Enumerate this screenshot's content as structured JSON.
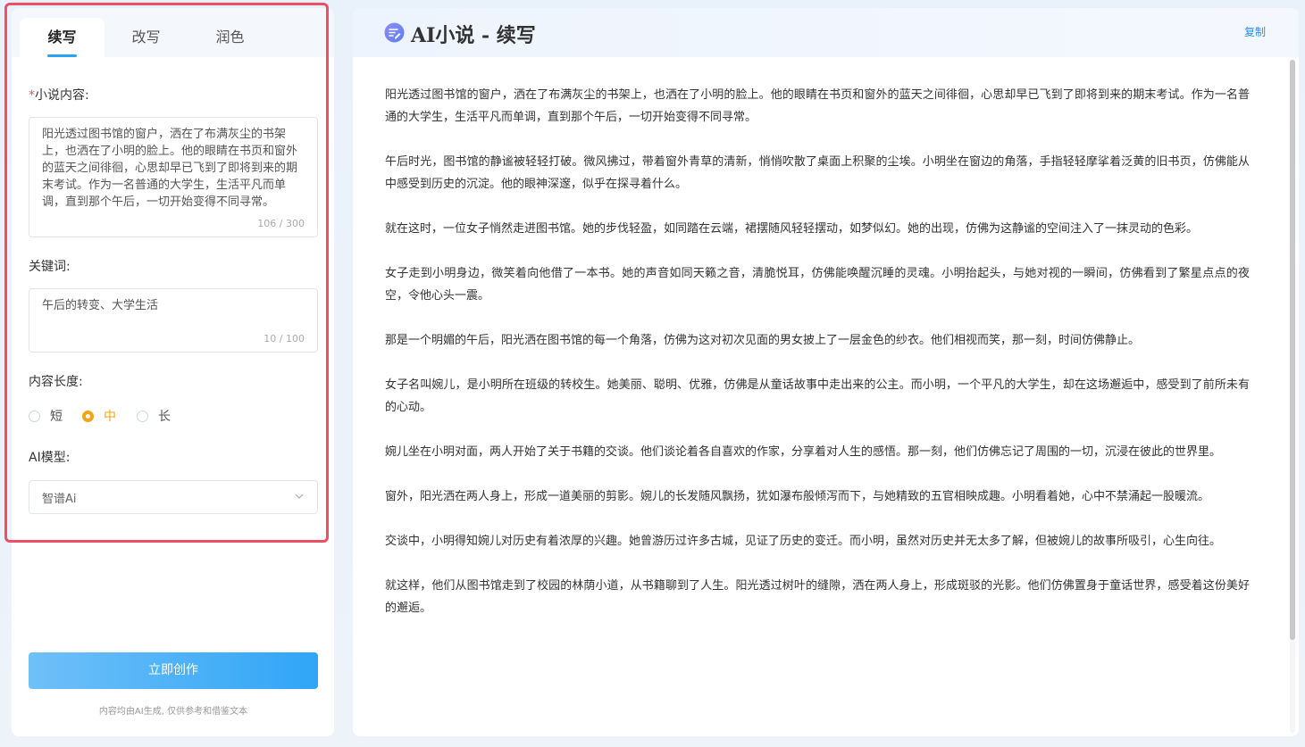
{
  "tabs": [
    {
      "label": "续写",
      "active": true
    },
    {
      "label": "改写",
      "active": false
    },
    {
      "label": "润色",
      "active": false
    }
  ],
  "form": {
    "novel_content": {
      "required_mark": "*",
      "label": "小说内容:",
      "value": "阳光透过图书馆的窗户，洒在了布满灰尘的书架上，也洒在了小明的脸上。他的眼睛在书页和窗外的蓝天之间徘徊，心思却早已飞到了即将到来的期末考试。作为一名普通的大学生，生活平凡而单调，直到那个午后，一切开始变得不同寻常。",
      "counter": "106 / 300"
    },
    "keywords": {
      "label": "关键词:",
      "value": "午后的转变、大学生活",
      "counter": "10 / 100"
    },
    "length": {
      "label": "内容长度:",
      "options": [
        "短",
        "中",
        "长"
      ],
      "selected": "中"
    },
    "model": {
      "label": "AI模型:",
      "selected": "智谱Ai"
    },
    "submit_label": "立即创作",
    "disclaimer": "内容均由AI生成, 仅供参考和借鉴文本"
  },
  "output": {
    "title": "AI小说 - 续写",
    "copy_label": "复制",
    "paragraphs": [
      "阳光透过图书馆的窗户，洒在了布满灰尘的书架上，也洒在了小明的脸上。他的眼睛在书页和窗外的蓝天之间徘徊，心思却早已飞到了即将到来的期末考试。作为一名普通的大学生，生活平凡而单调，直到那个午后，一切开始变得不同寻常。",
      "午后时光，图书馆的静谧被轻轻打破。微风拂过，带着窗外青草的清新，悄悄吹散了桌面上积聚的尘埃。小明坐在窗边的角落，手指轻轻摩挲着泛黄的旧书页，仿佛能从中感受到历史的沉淀。他的眼神深邃，似乎在探寻着什么。",
      "就在这时，一位女子悄然走进图书馆。她的步伐轻盈，如同踏在云端，裙摆随风轻轻摆动，如梦似幻。她的出现，仿佛为这静谧的空间注入了一抹灵动的色彩。",
      "女子走到小明身边，微笑着向他借了一本书。她的声音如同天籁之音，清脆悦耳，仿佛能唤醒沉睡的灵魂。小明抬起头，与她对视的一瞬间，仿佛看到了繁星点点的夜空，令他心头一震。",
      "那是一个明媚的午后，阳光洒在图书馆的每一个角落，仿佛为这对初次见面的男女披上了一层金色的纱衣。他们相视而笑，那一刻，时间仿佛静止。",
      "女子名叫婉儿，是小明所在班级的转校生。她美丽、聪明、优雅，仿佛是从童话故事中走出来的公主。而小明，一个平凡的大学生，却在这场邂逅中，感受到了前所未有的心动。",
      "婉儿坐在小明对面，两人开始了关于书籍的交谈。他们谈论着各自喜欢的作家，分享着对人生的感悟。那一刻，他们仿佛忘记了周围的一切，沉浸在彼此的世界里。",
      "窗外，阳光洒在两人身上，形成一道美丽的剪影。婉儿的长发随风飘扬，犹如瀑布般倾泻而下，与她精致的五官相映成趣。小明看着她，心中不禁涌起一股暖流。",
      "交谈中，小明得知婉儿对历史有着浓厚的兴趣。她曾游历过许多古城，见证了历史的变迁。而小明，虽然对历史并无太多了解，但被婉儿的故事所吸引，心生向往。",
      "就这样，他们从图书馆走到了校园的林荫小道，从书籍聊到了人生。阳光透过树叶的缝隙，洒在两人身上，形成斑驳的光影。他们仿佛置身于童话世界，感受着这份美好的邂逅。"
    ]
  },
  "colors": {
    "accent": "#2aa1f5",
    "highlight_border": "#ee4e66",
    "radio_selected": "#f2a516",
    "link": "#2b8cef"
  },
  "icons": {
    "title_icon": "edit-badge-icon",
    "select_arrow": "chevron-down-icon"
  }
}
